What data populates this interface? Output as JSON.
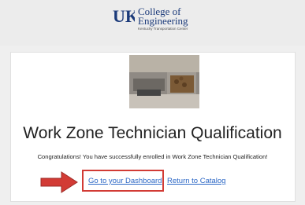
{
  "header": {
    "logo_line1": "College of",
    "logo_line2": "Engineering",
    "logo_sub": "Kentucky Transportation Center",
    "logo_mark": "UK",
    "brand_color": "#1b3a7a"
  },
  "course": {
    "image_icon": "kitchen-tray-photo",
    "title": "Work Zone Technician Qualification",
    "message": "Congratulations! You have successfully enrolled in Work Zone Technician Qualification!"
  },
  "actions": {
    "dashboard_label": "Go to your Dashboard",
    "catalog_label": "Return to Catalog",
    "link_color": "#2a66c5",
    "highlight_color": "#d23b35"
  }
}
